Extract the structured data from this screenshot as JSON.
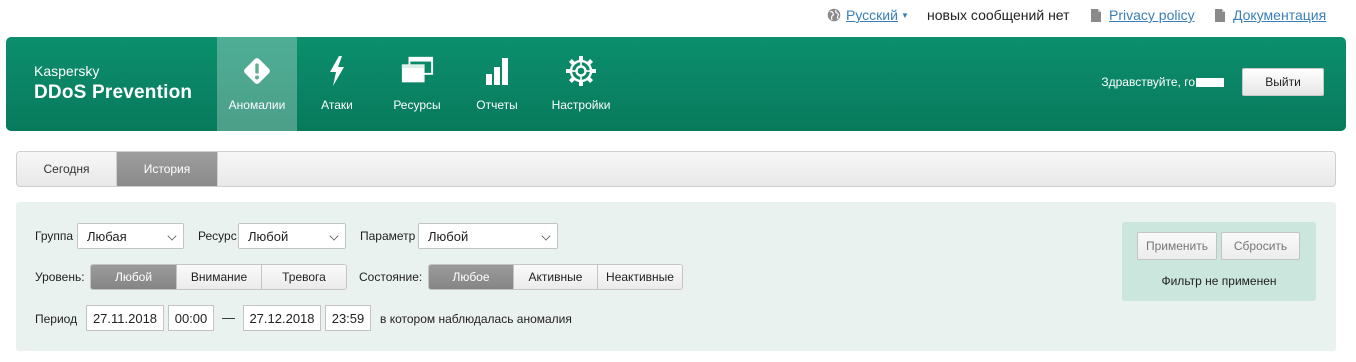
{
  "topbar": {
    "language": "Русский",
    "messages": "новых сообщений нет",
    "privacy": "Privacy policy",
    "docs": "Документация"
  },
  "header": {
    "brand_top": "Kaspersky",
    "brand_main": "DDoS Prevention",
    "nav": [
      {
        "label": "Аномалии",
        "icon": "warning-diamond-icon"
      },
      {
        "label": "Атаки",
        "icon": "lightning-icon"
      },
      {
        "label": "Ресурсы",
        "icon": "windows-icon"
      },
      {
        "label": "Отчеты",
        "icon": "bar-chart-icon"
      },
      {
        "label": "Настройки",
        "icon": "gear-icon"
      }
    ],
    "greeting": "Здравствуйте, го",
    "logout": "Выйти"
  },
  "tabs": [
    {
      "label": "Сегодня"
    },
    {
      "label": "История"
    }
  ],
  "filters": {
    "group_label": "Группа",
    "group_value": "Любая",
    "resource_label": "Ресурс",
    "resource_value": "Любой",
    "param_label": "Параметр",
    "param_value": "Любой",
    "level_label": "Уровень:",
    "level_options": [
      "Любой",
      "Внимание",
      "Тревога"
    ],
    "state_label": "Состояние:",
    "state_options": [
      "Любое",
      "Активные",
      "Неактивные"
    ],
    "period_label": "Период",
    "date_from": "27.11.2018",
    "time_from": "00:00",
    "dash": "—",
    "date_to": "27.12.2018",
    "time_to": "23:59",
    "period_suffix": "в котором наблюдалась аномалия"
  },
  "apply": {
    "apply_label": "Применить",
    "reset_label": "Сбросить",
    "status": "Фильтр не применен"
  },
  "colors": {
    "header_green": "#0b8f6d",
    "panel_bg": "#e9f2ee",
    "link_blue": "#3a7fb8"
  }
}
